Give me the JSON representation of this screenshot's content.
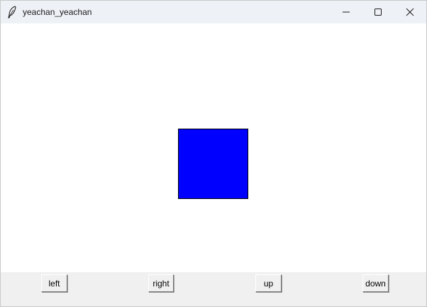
{
  "window": {
    "title": "yeachan_yeachan",
    "app_icon": "feather-icon",
    "controls": {
      "minimize_icon": "minimize-icon",
      "maximize_icon": "maximize-icon",
      "close_icon": "close-icon"
    }
  },
  "canvas": {
    "background": "#ffffff",
    "square_color": "#0000ff"
  },
  "buttons": {
    "left": "left",
    "right": "right",
    "up": "up",
    "down": "down"
  }
}
